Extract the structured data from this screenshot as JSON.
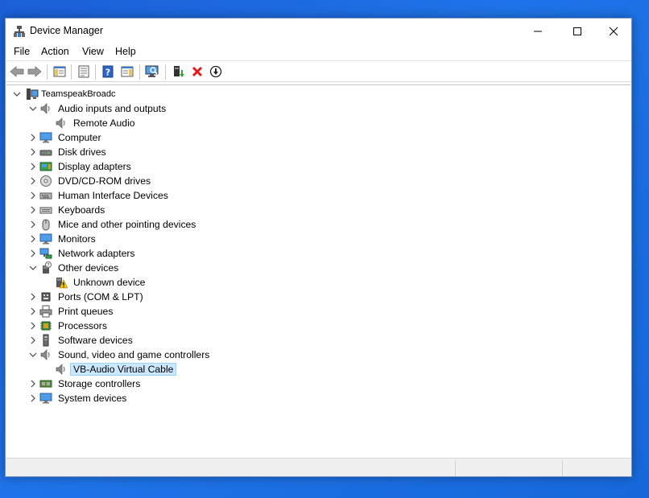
{
  "window": {
    "title": "Device Manager"
  },
  "menu": [
    "File",
    "Action",
    "View",
    "Help"
  ],
  "toolbar": {
    "buttons": [
      "back-icon",
      "forward-icon",
      "show-hide-console-tree-icon",
      "properties-icon",
      "help-icon",
      "action-pane-icon",
      "scan-hardware-icon",
      "update-driver-icon",
      "uninstall-icon",
      "disable-device-icon"
    ]
  },
  "tree": {
    "root": "TeamspeakBroadc",
    "nodes": [
      {
        "label": "Audio inputs and outputs",
        "level": 1,
        "expanded": true,
        "icon": "speaker-icon"
      },
      {
        "label": "Remote Audio",
        "level": 2,
        "icon": "speaker-icon"
      },
      {
        "label": "Computer",
        "level": 1,
        "expanded": false,
        "icon": "monitor-icon"
      },
      {
        "label": "Disk drives",
        "level": 1,
        "expanded": false,
        "icon": "disk-drive-icon"
      },
      {
        "label": "Display adapters",
        "level": 1,
        "expanded": false,
        "icon": "display-adapter-icon"
      },
      {
        "label": "DVD/CD-ROM drives",
        "level": 1,
        "expanded": false,
        "icon": "dvd-icon"
      },
      {
        "label": "Human Interface Devices",
        "level": 1,
        "expanded": false,
        "icon": "hid-icon"
      },
      {
        "label": "Keyboards",
        "level": 1,
        "expanded": false,
        "icon": "keyboard-icon"
      },
      {
        "label": "Mice and other pointing devices",
        "level": 1,
        "expanded": false,
        "icon": "mouse-icon"
      },
      {
        "label": "Monitors",
        "level": 1,
        "expanded": false,
        "icon": "monitor-icon"
      },
      {
        "label": "Network adapters",
        "level": 1,
        "expanded": false,
        "icon": "network-adapter-icon"
      },
      {
        "label": "Other devices",
        "level": 1,
        "expanded": true,
        "icon": "other-device-icon"
      },
      {
        "label": "Unknown device",
        "level": 2,
        "icon": "warning-device-icon"
      },
      {
        "label": "Ports (COM & LPT)",
        "level": 1,
        "expanded": false,
        "icon": "port-icon"
      },
      {
        "label": "Print queues",
        "level": 1,
        "expanded": false,
        "icon": "printer-icon"
      },
      {
        "label": "Processors",
        "level": 1,
        "expanded": false,
        "icon": "processor-icon"
      },
      {
        "label": "Software devices",
        "level": 1,
        "expanded": false,
        "icon": "software-device-icon"
      },
      {
        "label": "Sound, video and game controllers",
        "level": 1,
        "expanded": true,
        "icon": "speaker-icon"
      },
      {
        "label": "VB-Audio Virtual Cable",
        "level": 2,
        "icon": "speaker-icon",
        "selected": true
      },
      {
        "label": "Storage controllers",
        "level": 1,
        "expanded": false,
        "icon": "storage-controller-icon"
      },
      {
        "label": "System devices",
        "level": 1,
        "expanded": false,
        "icon": "system-device-icon"
      }
    ]
  },
  "colors": {
    "desktop": "#1f73e8",
    "selection": "#cce8ff",
    "selection_border": "#99d1ff"
  }
}
